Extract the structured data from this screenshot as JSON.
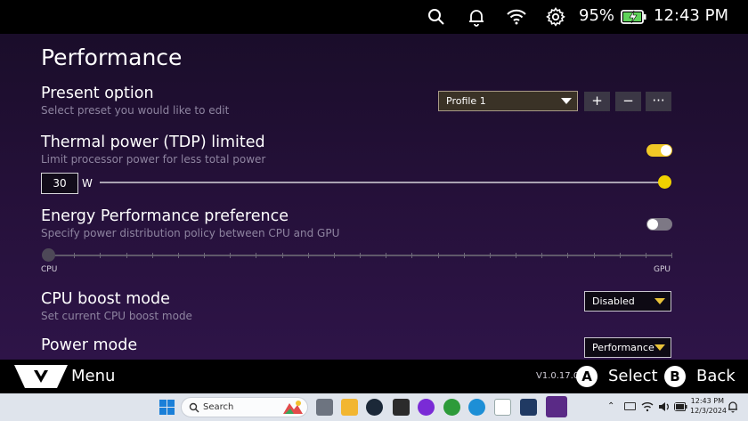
{
  "status": {
    "battery_percent": "95%",
    "time": "12:43 PM"
  },
  "page": {
    "title": "Performance"
  },
  "present_option": {
    "title": "Present option",
    "description": "Select preset you would like to edit",
    "selected_profile": "Profile 1",
    "add_label": "+",
    "remove_label": "−",
    "more_label": "···"
  },
  "tdp": {
    "title": "Thermal power (TDP) limited",
    "description": "Limit processor power for less total power",
    "enabled": true,
    "value": "30",
    "unit": "W",
    "slider_fraction": 1.0
  },
  "epp": {
    "title": "Energy Performance preference",
    "description": "Specify power distribution policy between CPU and GPU",
    "enabled": false,
    "left_label": "CPU",
    "right_label": "GPU",
    "slider_fraction": 0.0
  },
  "cpu_boost": {
    "title": "CPU boost mode",
    "description": "Set current CPU boost mode",
    "selected": "Disabled"
  },
  "power_mode": {
    "title": "Power mode",
    "selected": "Performance"
  },
  "footer": {
    "menu_label": "Menu",
    "version": "V1.0.17.0",
    "a_button": "A",
    "select_label": "Select",
    "b_button": "B",
    "back_label": "Back"
  },
  "taskbar": {
    "search_placeholder": "Search",
    "time": "12:43 PM",
    "date": "12/3/2024"
  },
  "colors": {
    "accent": "#f0c826",
    "panel_top": "#1a0d2a",
    "panel_bottom": "#2e1448",
    "muted_text": "#8e84a0"
  }
}
